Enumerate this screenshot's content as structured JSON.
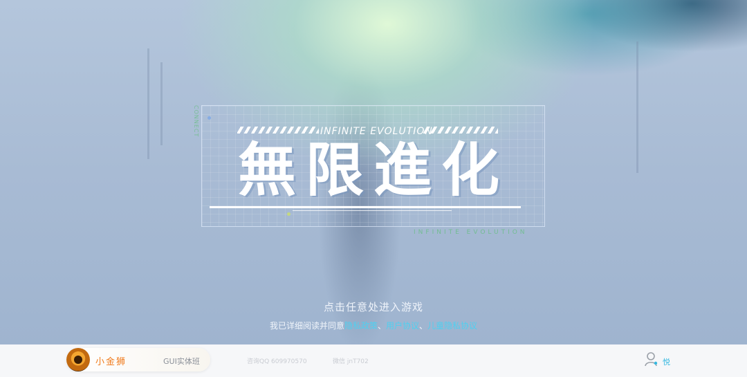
{
  "game": {
    "subtitle": "INFINITE EVOLUTION",
    "logo_text": "無限進化",
    "side_vertical": "CONNECT",
    "side_spaced": "INFINITE EVOLUTION",
    "enter_prompt": "点击任意处进入游戏",
    "agreement": {
      "prefix": "我已详细阅读并同意",
      "privacy": "隐私政策",
      "sep1": "、",
      "user": "用户协议",
      "sep2": "、",
      "children": "儿童隐私协议"
    }
  },
  "footer": {
    "brand_name": "小金狮",
    "course": "GUI实体班",
    "qq": "咨询QQ 609970570",
    "wechat": "微信 jnT702",
    "username": "悦"
  },
  "colors": {
    "accent_link": "#4fd0f0",
    "brand_orange": "#f07a1a",
    "footer_bg": "#f6f7f9"
  },
  "icons": [
    "user-icon",
    "lion-avatar-icon"
  ]
}
